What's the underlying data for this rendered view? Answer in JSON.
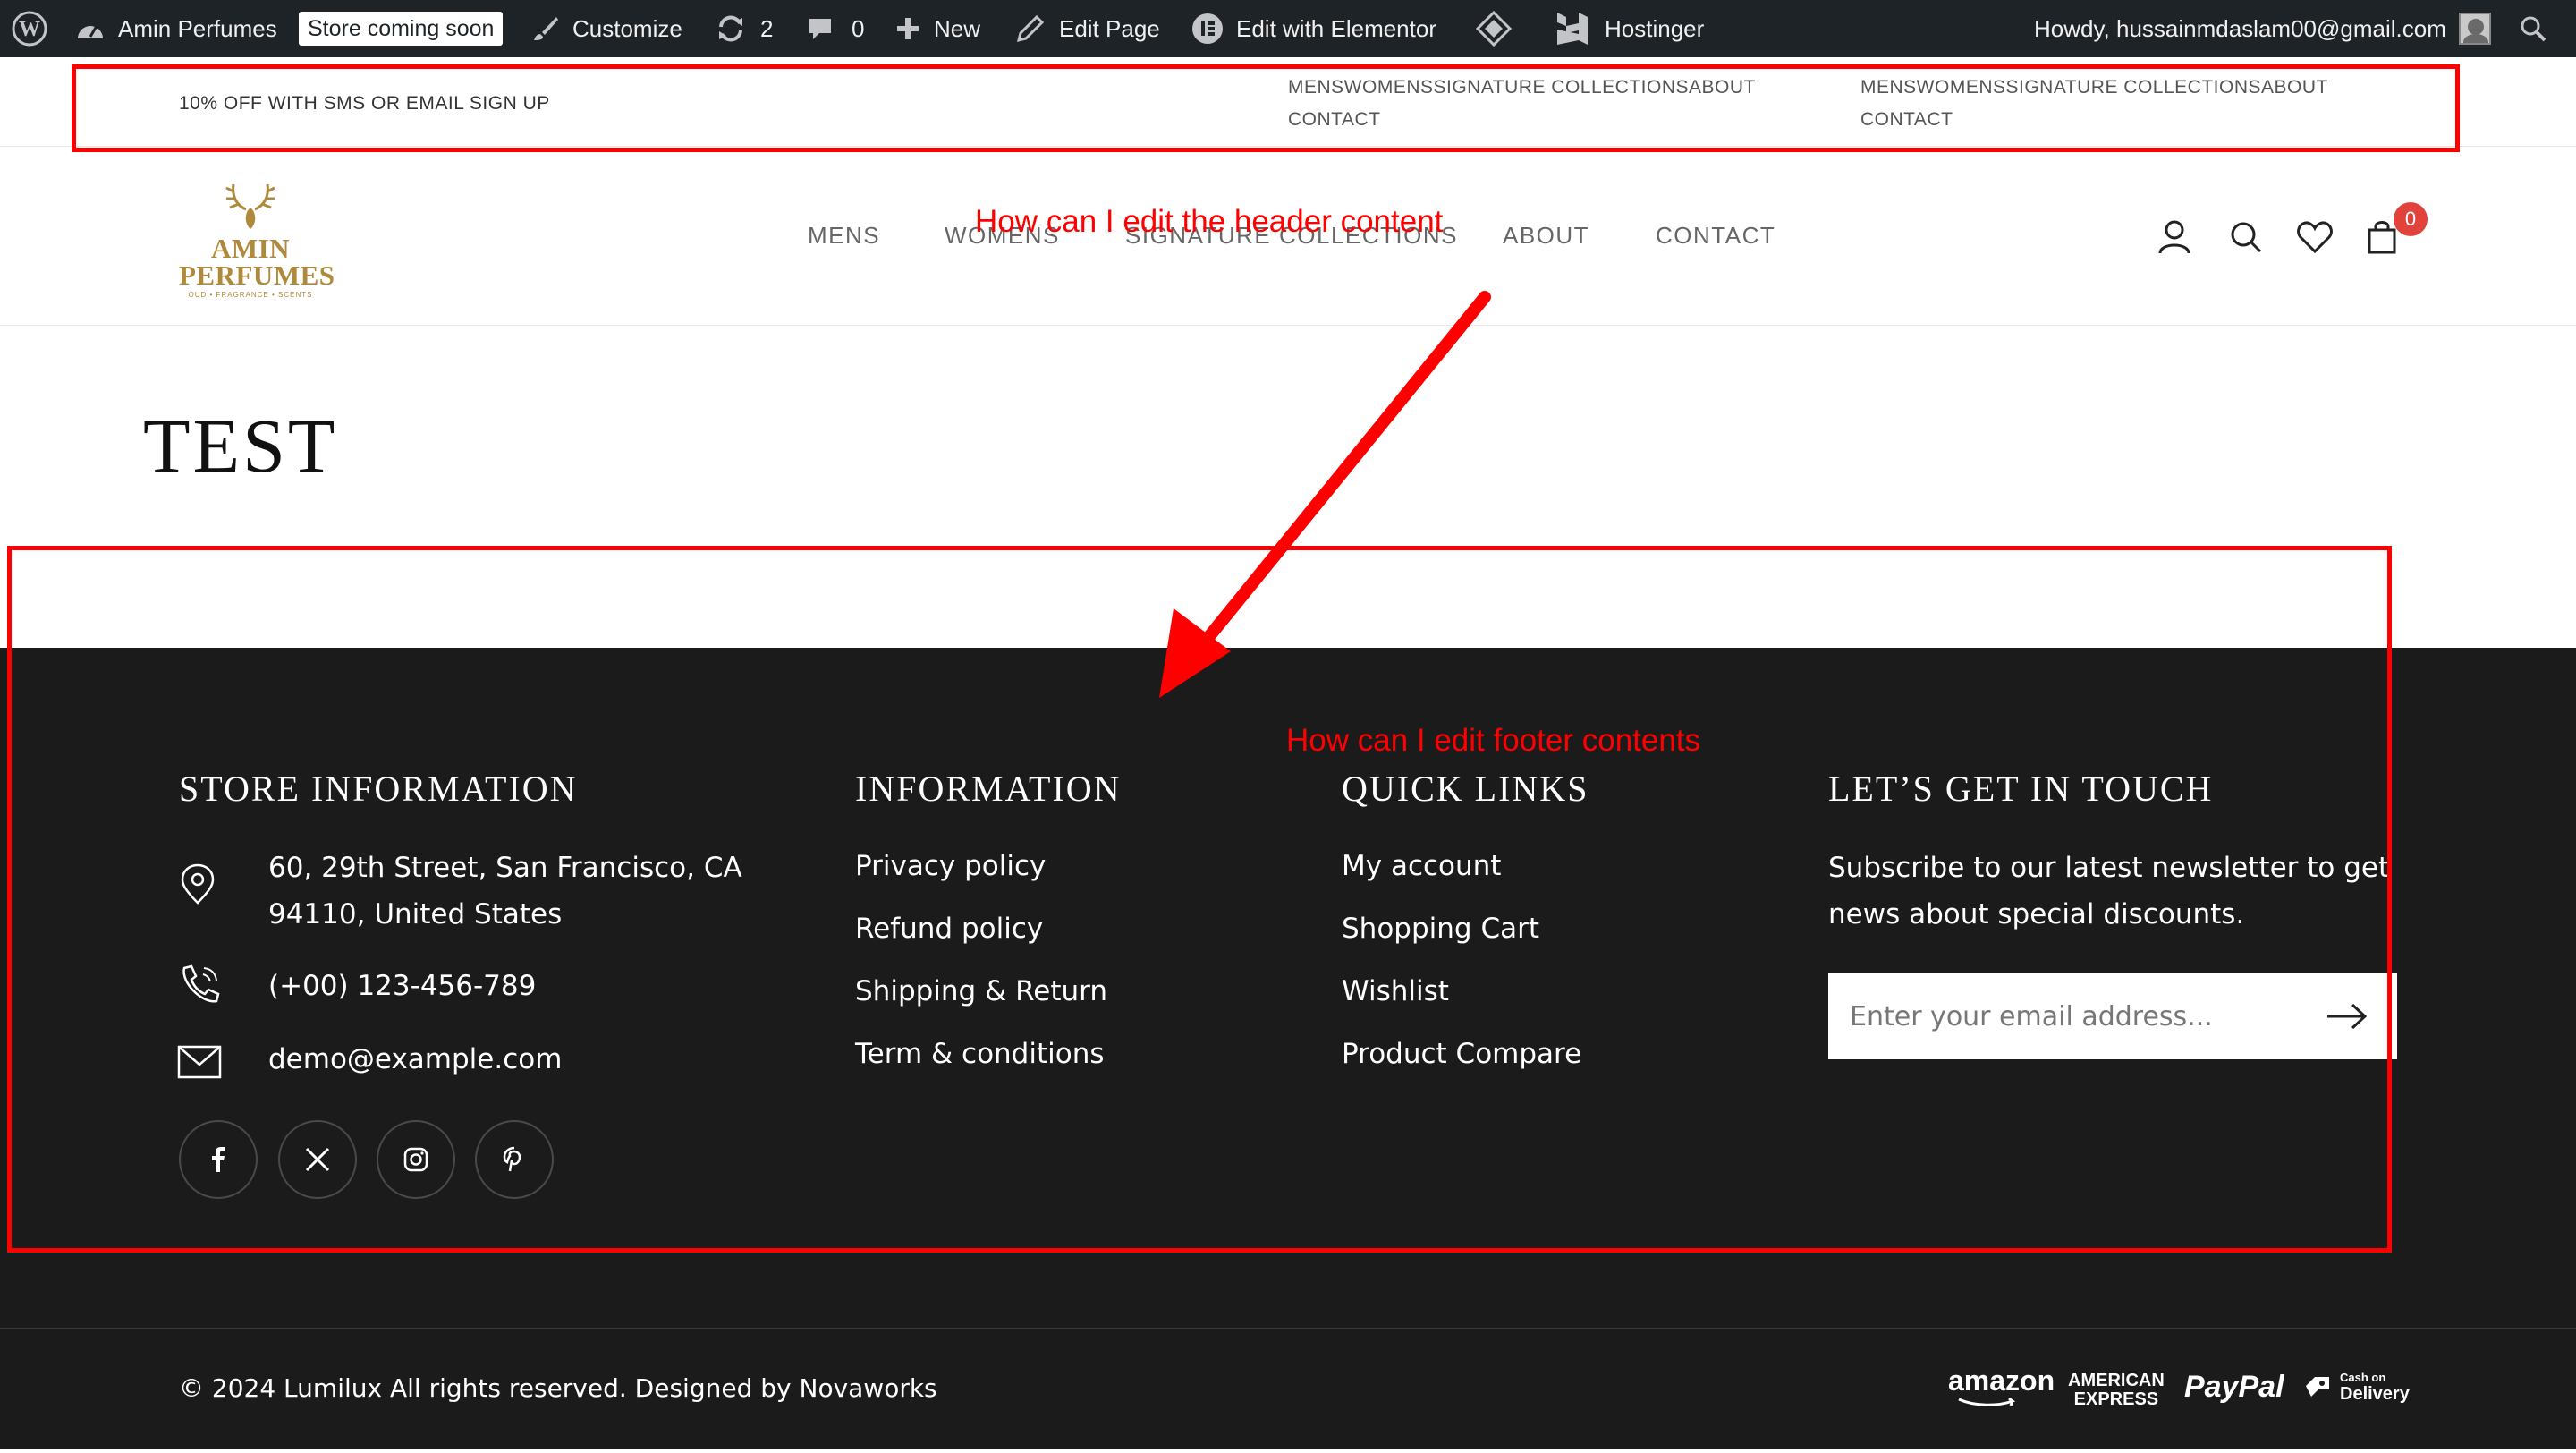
{
  "admin_bar": {
    "site_name": "Amin Perfumes",
    "store_badge": "Store coming soon",
    "customize": "Customize",
    "updates_count": "2",
    "comments_count": "0",
    "new_label": "New",
    "edit_page": "Edit Page",
    "edit_elementor": "Edit with Elementor",
    "hostinger": "Hostinger",
    "howdy": "Howdy, hussainmdaslam00@gmail.com"
  },
  "topbar": {
    "promo": "10% OFF WITH SMS OR EMAIL SIGN UP",
    "menu_line1": "MENSWOMENSSIGNATURE COLLECTIONSABOUT",
    "menu_line2": "CONTACT"
  },
  "header": {
    "logo_line1": "AMIN",
    "logo_line2": "PERFUMES",
    "logo_tagline": "OUD • FRAGRANCE • SCENTS",
    "nav": [
      "MENS",
      "WOMENS",
      "SIGNATURE COLLECTIONS",
      "ABOUT",
      "CONTACT"
    ],
    "cart_count": "0"
  },
  "page": {
    "title": "TEST"
  },
  "footer": {
    "store_info": {
      "heading": "STORE INFORMATION",
      "address_line1": "60, 29th Street, San Francisco, CA",
      "address_line2": "94110, United States",
      "phone": "(+00) 123-456-789",
      "email": "demo@example.com"
    },
    "information": {
      "heading": "INFORMATION",
      "links": [
        "Privacy policy",
        "Refund policy",
        "Shipping & Return",
        "Term & conditions"
      ]
    },
    "quick_links": {
      "heading": "QUICK LINKS",
      "links": [
        "My account",
        "Shopping Cart",
        "Wishlist",
        "Product Compare"
      ]
    },
    "touch": {
      "heading": "LET’S GET IN TOUCH",
      "text_line1": "Subscribe to our latest newsletter to get",
      "text_line2": "news about special discounts.",
      "placeholder": "Enter your email address..."
    },
    "social": [
      "facebook-icon",
      "x-icon",
      "instagram-icon",
      "pinterest-icon"
    ],
    "copyright": "© 2024 Lumilux All rights reserved. Designed by Novaworks",
    "payments": {
      "amazon": "amazon",
      "amex_line1": "AMERICAN",
      "amex_line2": "EXPRESS",
      "paypal": "PayPal",
      "cod_line1": "Cash on",
      "cod_line2": "Delivery"
    }
  },
  "annotations": {
    "header_question": "How can I edit the header content",
    "footer_question": "How can I edit footer contents",
    "color": "#ff0000"
  }
}
